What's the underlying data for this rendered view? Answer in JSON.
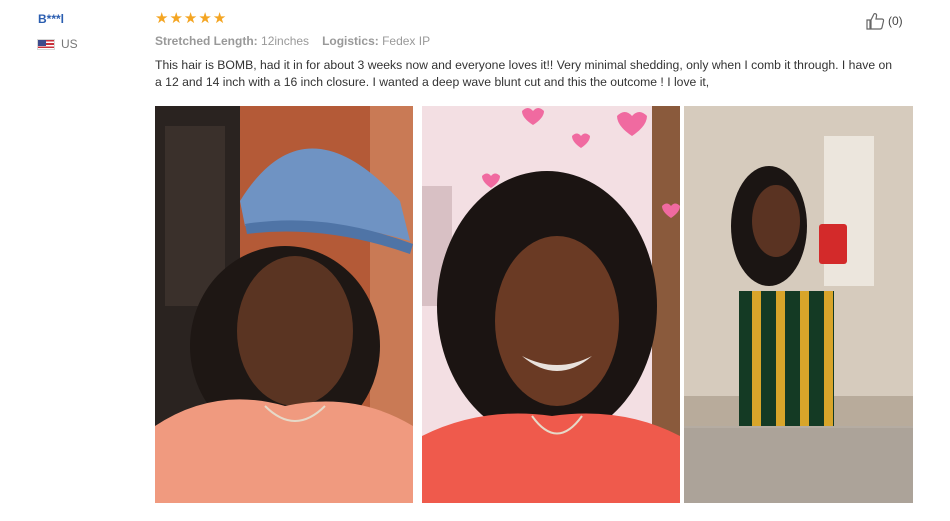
{
  "review": {
    "user_name": "B***l",
    "country": "US",
    "flag_icon": "us-flag-icon",
    "rating": 5,
    "star_icon": "star-icon",
    "star_color": "#f4a522",
    "helpful_icon": "thumbs-up-icon",
    "helpful_count": "(0)",
    "stretched_length_label": "Stretched Length:",
    "stretched_length_value": "12inches",
    "logistics_label": "Logistics:",
    "logistics_value": "Fedex IP",
    "text": "This hair is BOMB, had it in for about 3 weeks now and everyone loves it!! Very minimal shedding, only when I comb it through. I have on a 12 and 14 inch with a 16 inch closure. I wanted a deep wave blunt cut and this the outcome ! I love it,",
    "photo_count": 3
  }
}
